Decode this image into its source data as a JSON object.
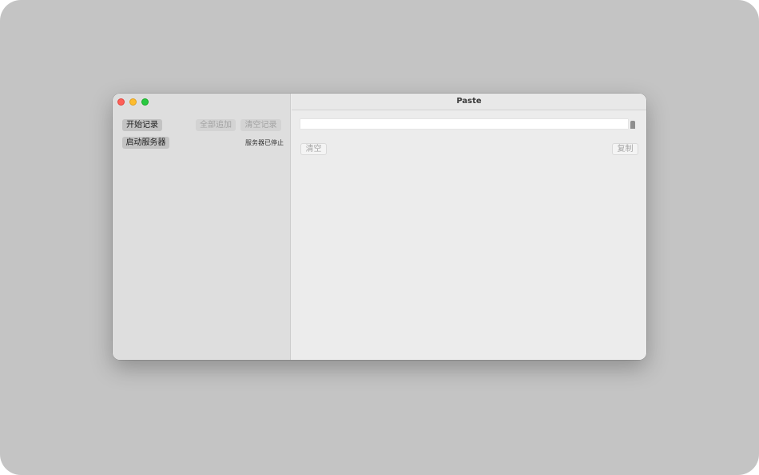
{
  "window": {
    "title": "Paste"
  },
  "sidebar": {
    "start_record_label": "开始记录",
    "add_all_label": "全部追加",
    "clear_records_label": "清空记录",
    "start_server_label": "启动服务器",
    "server_status": "服务器已停止"
  },
  "main": {
    "input_value": "",
    "clear_label": "清空",
    "copy_label": "复制"
  },
  "colors": {
    "close": "#fe5f57",
    "minimize": "#febc2e",
    "maximize": "#28c840"
  }
}
